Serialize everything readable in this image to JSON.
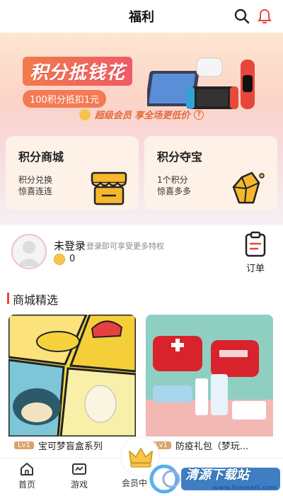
{
  "header": {
    "title": "福利"
  },
  "banner": {
    "title": "积分抵钱花",
    "subtitle": "100积分抵扣1元",
    "vip_text": "超级会员 享全场更低价",
    "vip_help": "?"
  },
  "cards": [
    {
      "title": "积分商城",
      "desc_line1": "积分兑换",
      "desc_line2": "惊喜连连"
    },
    {
      "title": "积分夺宝",
      "desc_line1": "1个积分",
      "desc_line2": "惊喜多多"
    }
  ],
  "user": {
    "name": "未登录",
    "hint": "登录即可享受更多特权",
    "points": "0",
    "order_label": "订单"
  },
  "section": {
    "title": "商城精选"
  },
  "products": [
    {
      "level": "Lv1",
      "name": "宝可梦盲盒系列"
    },
    {
      "level": "Lv1",
      "name": "防疫礼包（梦玩..."
    }
  ],
  "tabbar": {
    "items": [
      {
        "label": "首页",
        "icon": "home-icon"
      },
      {
        "label": "游戏",
        "icon": "game-icon"
      },
      {
        "label": "会员中",
        "icon": "crown-icon"
      }
    ]
  },
  "watermark": {
    "text": "清源下载站",
    "url": "www.fonmeit.com"
  },
  "colors": {
    "accent": "#e8463b",
    "brand_orange": "#f47a55",
    "card_bg": "#fdf1e8"
  }
}
